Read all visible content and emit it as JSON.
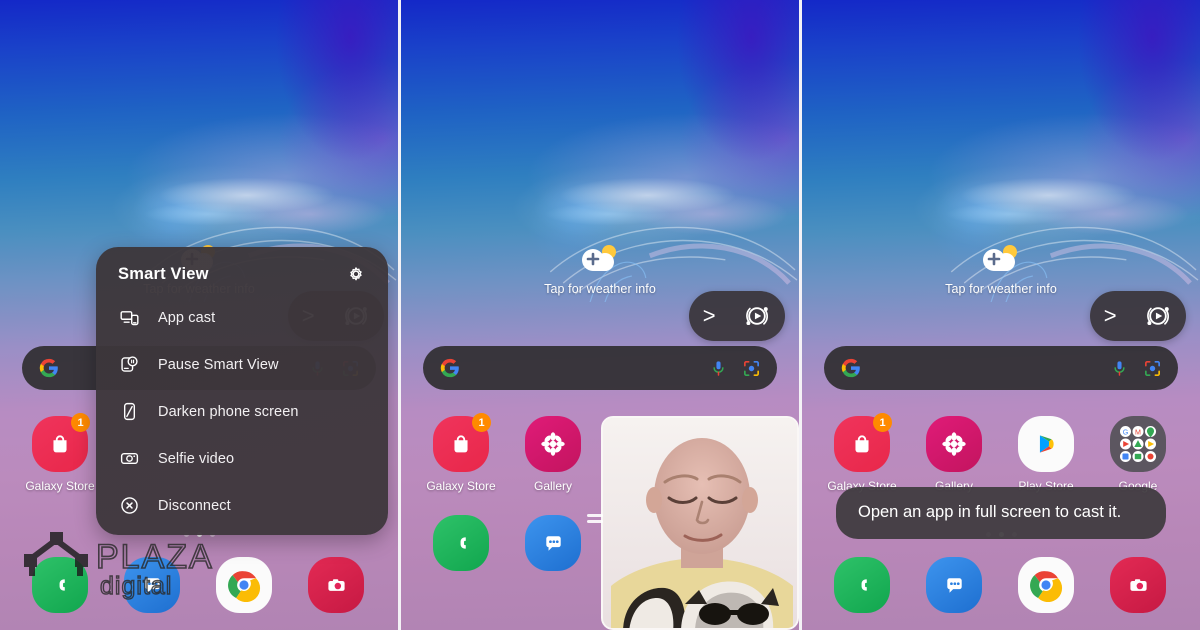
{
  "meta": {
    "description": "Samsung Galaxy home screen triptych showing Smart View casting menu, selfie video overlay, and cast toast message"
  },
  "common": {
    "weather_widget_label": "Tap for weather info",
    "weather_icon": "cloud-plus-sun-icon",
    "search": {
      "placeholder": "",
      "value": "",
      "google_logo": "google-g-icon",
      "mic_icon": "microphone-icon",
      "lens_icon": "google-lens-icon"
    },
    "smart_view_pill": {
      "expand_icon": "chevron-right-icon",
      "cast_icon": "smart-view-cast-icon",
      "expand_label": ">"
    },
    "page_dots": {
      "count": 3,
      "active_index": 1
    }
  },
  "panel1": {
    "smart_view_menu": {
      "title": "Smart View",
      "settings_icon": "gear-icon",
      "items": [
        {
          "label": "App cast",
          "icon": "app-cast-icon"
        },
        {
          "label": "Pause Smart View",
          "icon": "pause-smart-view-icon"
        },
        {
          "label": "Darken phone screen",
          "icon": "darken-phone-screen-icon"
        },
        {
          "label": "Selfie video",
          "icon": "selfie-video-icon"
        },
        {
          "label": "Disconnect",
          "icon": "disconnect-icon"
        }
      ]
    },
    "apps_row1": [
      {
        "label": "Galaxy Store",
        "icon": "galaxy-store-icon",
        "badge": "1",
        "color": "#e8274a"
      }
    ],
    "apps_row2": [
      {
        "label": "",
        "icon": "phone-icon",
        "color": "#1eb25a"
      },
      {
        "label": "",
        "icon": "messages-icon",
        "color": "#2a7fe0"
      },
      {
        "label": "",
        "icon": "chrome-icon",
        "color": "#ffffff"
      },
      {
        "label": "",
        "icon": "camera-icon",
        "color": "#d6214b"
      }
    ],
    "watermark": {
      "line1": "PLAZA",
      "line2": "digital",
      "logo": "house-logo-icon"
    }
  },
  "panel2": {
    "apps_row1": [
      {
        "label": "Galaxy Store",
        "icon": "galaxy-store-icon",
        "badge": "1",
        "color": "#e8274a"
      },
      {
        "label": "Gallery",
        "icon": "gallery-icon",
        "badge": "",
        "color": "#d6176b"
      }
    ],
    "apps_row2": [
      {
        "label": "",
        "icon": "phone-icon",
        "color": "#1eb25a"
      },
      {
        "label": "",
        "icon": "messages-icon",
        "color": "#2a7fe0"
      }
    ],
    "selfie_overlay": {
      "name": "selfie-video-preview",
      "resize_handle": "drag-handle-icon"
    }
  },
  "panel3": {
    "toast_message": "Open an app in full screen to cast it.",
    "apps_row1": [
      {
        "label": "Galaxy Store",
        "icon": "galaxy-store-icon",
        "badge": "1",
        "color": "#e8274a"
      },
      {
        "label": "Gallery",
        "icon": "gallery-icon",
        "badge": "",
        "color": "#d6176b"
      },
      {
        "label": "Play Store",
        "icon": "play-store-icon",
        "badge": "",
        "color": "#ffffff"
      },
      {
        "label": "Google",
        "icon": "google-folder-icon",
        "badge": "",
        "color": "#5c5660"
      }
    ],
    "apps_row2": [
      {
        "label": "",
        "icon": "phone-icon",
        "color": "#1eb25a"
      },
      {
        "label": "",
        "icon": "messages-icon",
        "color": "#2a7fe0"
      },
      {
        "label": "",
        "icon": "chrome-icon",
        "color": "#ffffff"
      },
      {
        "label": "",
        "icon": "camera-icon",
        "color": "#d6214b"
      }
    ]
  },
  "colors": {
    "wallpaper_top": "#1428c8",
    "wallpaper_bottom": "#b184b3",
    "panel_dark": "#3c363a",
    "badge_orange": "#ff8a00",
    "accent_white": "#ffffff"
  }
}
